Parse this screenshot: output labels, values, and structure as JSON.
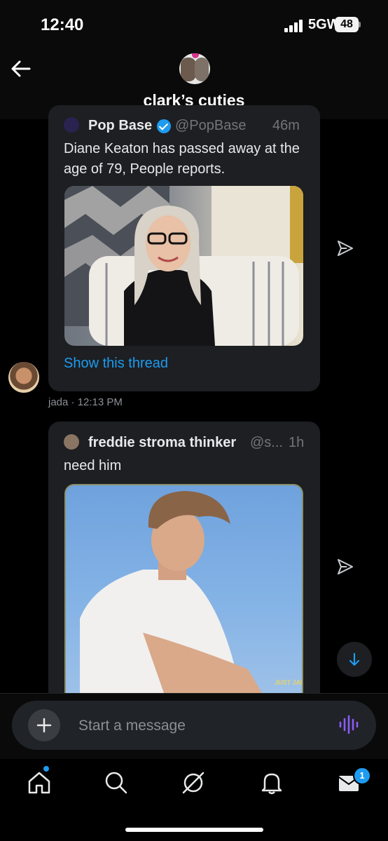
{
  "status_bar": {
    "time": "12:40",
    "network": "5GW",
    "battery": "48"
  },
  "header": {
    "title": "clark’s cuties"
  },
  "messages": [
    {
      "quoted_tweet": {
        "author_name": "Pop Base",
        "verified": true,
        "handle": "@PopBase",
        "age": "46m",
        "text": "Diane Keaton has passed away at the age of 79, People reports.",
        "show_thread_label": "Show this thread"
      },
      "sender": "jada",
      "timestamp": "12:13 PM",
      "meta": "jada · 12:13 PM"
    },
    {
      "quoted_tweet": {
        "author_name": "freddie stroma thinker",
        "handle": "@s...",
        "age": "1h",
        "text": "need him",
        "photo_watermark": "JUST JARED"
      }
    }
  ],
  "composer": {
    "placeholder": "Start a message"
  },
  "tabs": [
    {
      "name": "home",
      "icon": "home-icon",
      "has_dot": true
    },
    {
      "name": "search",
      "icon": "search-icon"
    },
    {
      "name": "grok",
      "icon": "grok-icon"
    },
    {
      "name": "notifications",
      "icon": "bell-icon"
    },
    {
      "name": "messages",
      "icon": "mail-icon",
      "badge": "1"
    }
  ],
  "colors": {
    "accent": "#1d9bf0",
    "card": "#1d1f22",
    "voice": "#8b5cf6"
  }
}
